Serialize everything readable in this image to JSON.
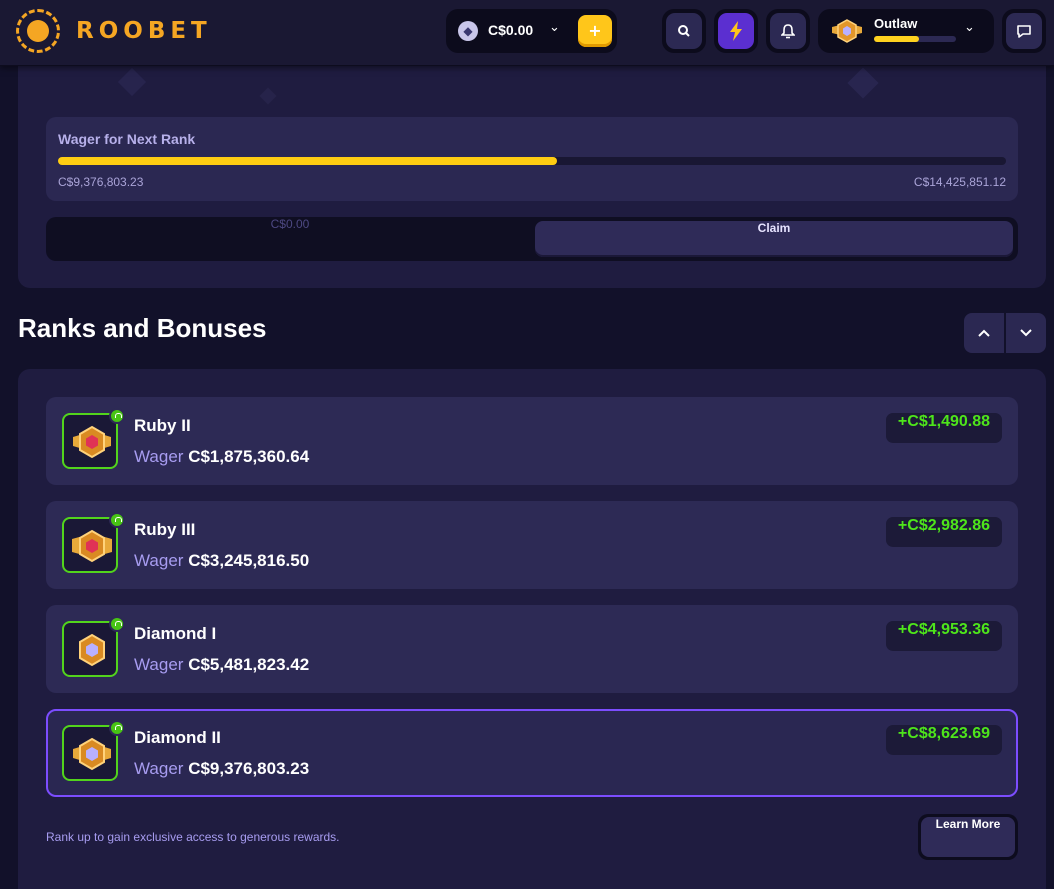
{
  "header": {
    "logo_text": "ROOBET",
    "wallet_amount": "C$0.00",
    "wallet_currency_icon": "eth-icon",
    "add_funds_icon": "plus-icon",
    "search_icon": "search-icon",
    "lightning_icon": "lightning-icon",
    "notification_icon": "bell-icon",
    "user": {
      "rank_name": "Outlaw",
      "progress_fraction": 0.55
    },
    "chat_icon": "chat-icon",
    "colors": {
      "accent": "#f5a623",
      "yellow": "#ffc61a",
      "purple": "#5b2fd0"
    }
  },
  "progress": {
    "title": "Wager for Next Rank",
    "current": "C$9,376,803.23",
    "target": "C$14,425,851.12",
    "fraction": 0.526
  },
  "claim": {
    "amount": "C$0.00",
    "button_label": "Claim"
  },
  "ranks_section": {
    "title": "Ranks and Bonuses",
    "up_icon": "chevron-up-icon",
    "down_icon": "chevron-down-icon",
    "ranks": [
      {
        "name": "Ruby II",
        "wager_label": "Wager",
        "wager_value": "C$1,875,360.64",
        "bonus": "+C$1,490.88",
        "gem": "ruby"
      },
      {
        "name": "Ruby III",
        "wager_label": "Wager",
        "wager_value": "C$3,245,816.50",
        "bonus": "+C$2,982.86",
        "gem": "ruby"
      },
      {
        "name": "Diamond I",
        "wager_label": "Wager",
        "wager_value": "C$5,481,823.42",
        "bonus": "+C$4,953.36",
        "gem": "diamond"
      },
      {
        "name": "Diamond II",
        "wager_label": "Wager",
        "wager_value": "C$9,376,803.23",
        "bonus": "+C$8,623.69",
        "gem": "diamond",
        "current": true
      }
    ],
    "footer_note": "Rank up to gain exclusive access to generous rewards.",
    "learn_more_label": "Learn More"
  }
}
